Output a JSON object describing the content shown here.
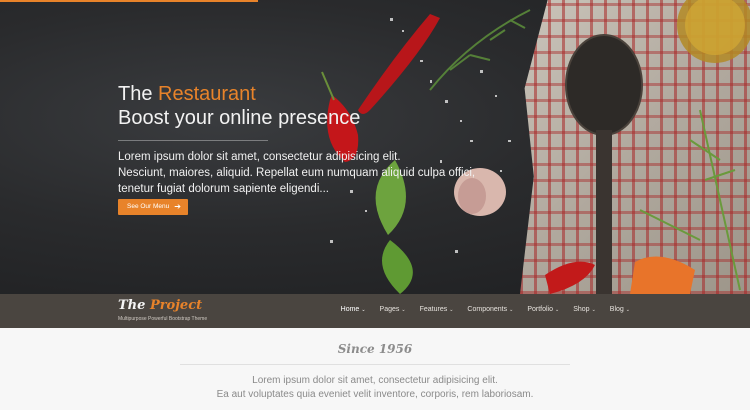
{
  "hero": {
    "title_prefix": "The ",
    "title_accent": "Restaurant",
    "subtitle": "Boost your online presence",
    "body_lines": [
      "Lorem ipsum dolor sit amet, consectetur adipisicing elit.",
      "Nesciunt, maiores, aliquid. Repellat eum numquam aliquid culpa offici,",
      "tenetur fugiat dolorum sapiente eligendi..."
    ],
    "cta_label": "See Our Menu",
    "cta_icon": "arrow-right-icon",
    "accent_color": "#e8832a"
  },
  "nav": {
    "logo_prefix": "The ",
    "logo_accent": "Project",
    "tagline": "Multipurpose Powerful Bootstrap Theme",
    "items": [
      {
        "label": "Home",
        "active": true
      },
      {
        "label": "Pages"
      },
      {
        "label": "Features"
      },
      {
        "label": "Components"
      },
      {
        "label": "Portfolio"
      },
      {
        "label": "Shop"
      },
      {
        "label": "Blog"
      }
    ],
    "bg_color": "#4a4540"
  },
  "intro": {
    "since": "Since 1956",
    "lines": [
      "Lorem ipsum dolor sit amet, consectetur adipisicing elit.",
      "Ea aut voluptates quia eveniet velit inventore, corporis, rem laboriosam."
    ]
  }
}
